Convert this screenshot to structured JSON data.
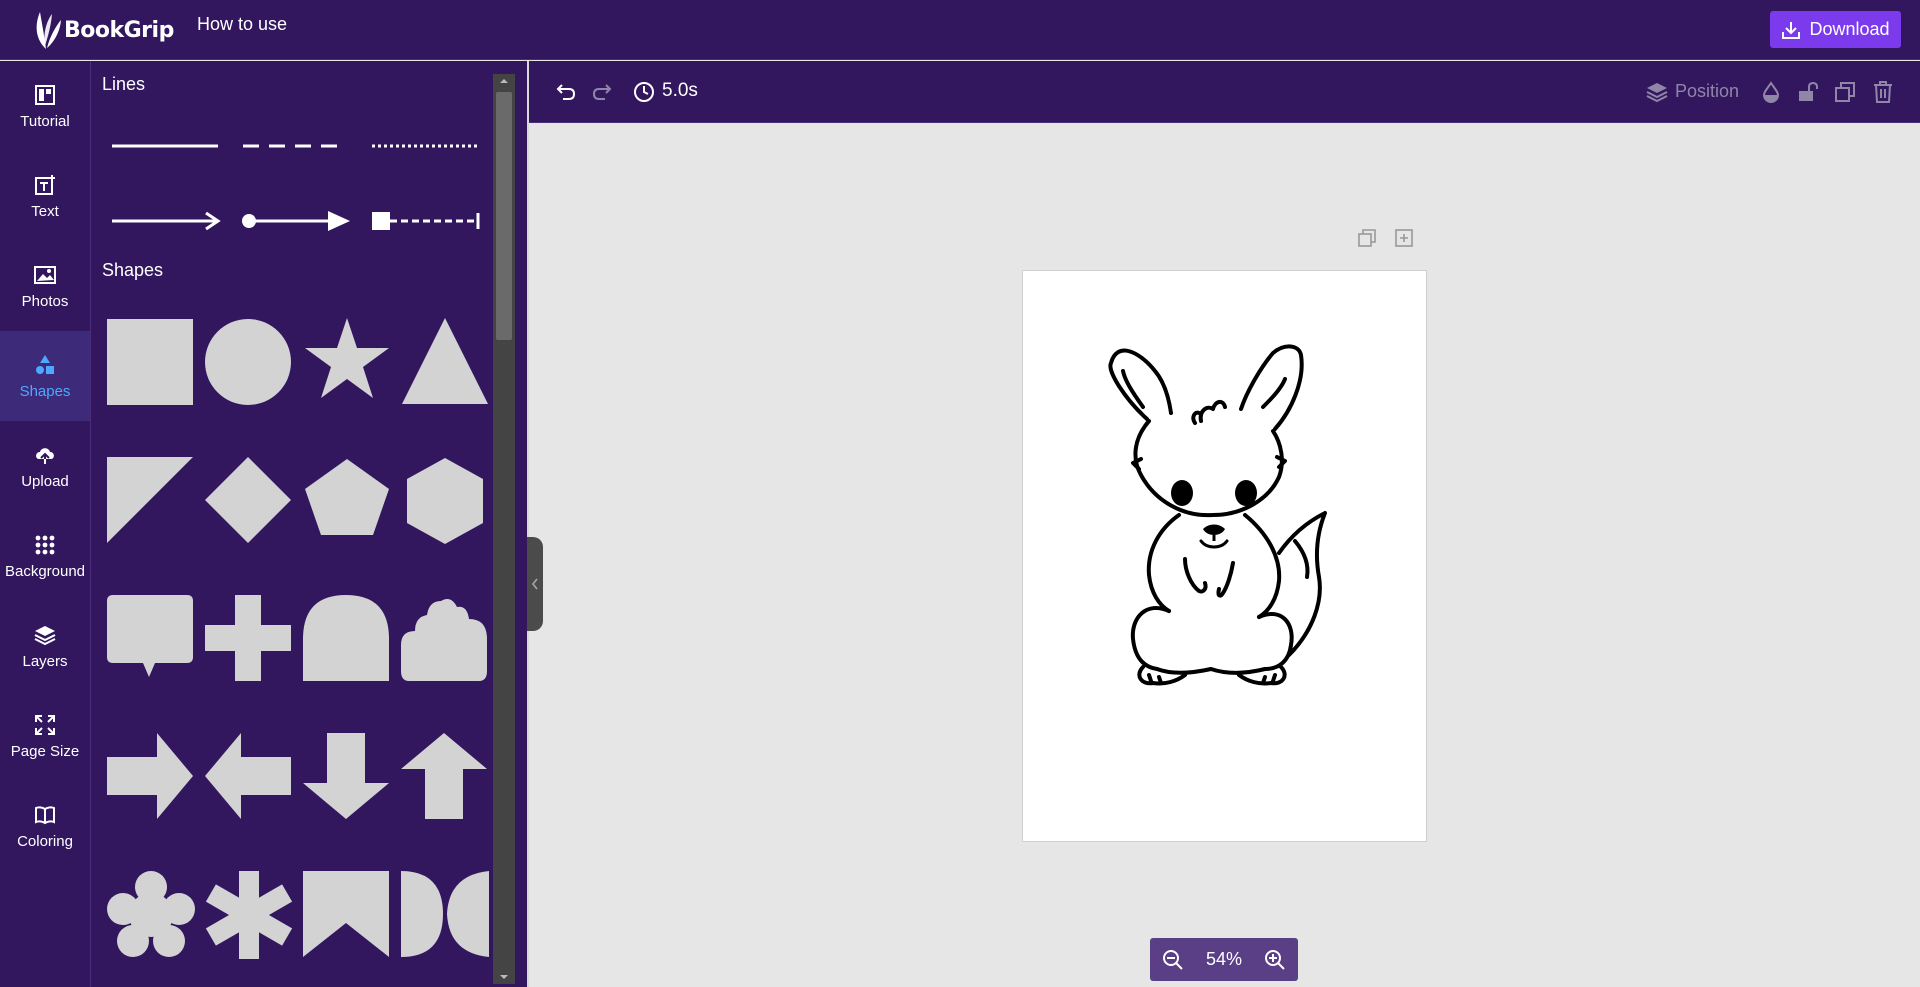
{
  "app": {
    "logo_text": "BookGrip"
  },
  "header": {
    "how_to_use": "How to use",
    "download_label": "Download"
  },
  "nav": {
    "items": [
      {
        "label": "Tutorial",
        "icon": "tutorial-icon"
      },
      {
        "label": "Text",
        "icon": "text-icon"
      },
      {
        "label": "Photos",
        "icon": "photos-icon"
      },
      {
        "label": "Shapes",
        "icon": "shapes-icon",
        "active": true
      },
      {
        "label": "Upload",
        "icon": "upload-icon"
      },
      {
        "label": "Background",
        "icon": "background-icon"
      },
      {
        "label": "Layers",
        "icon": "layers-icon"
      },
      {
        "label": "Page Size",
        "icon": "page-size-icon"
      },
      {
        "label": "Coloring",
        "icon": "coloring-icon"
      }
    ]
  },
  "panel": {
    "lines_title": "Lines",
    "shapes_title": "Shapes",
    "lines": [
      "solid-line",
      "dashed-line",
      "dotted-line",
      "arrow-line",
      "dot-arrow-line",
      "square-dashed-line"
    ],
    "shapes": [
      "square",
      "circle",
      "star",
      "triangle",
      "right-triangle",
      "diamond",
      "pentagon",
      "hexagon",
      "speech-bubble",
      "plus",
      "arch",
      "cloud",
      "arrow-right",
      "arrow-left",
      "arrow-down",
      "arrow-up",
      "flower",
      "asterisk",
      "bookmark",
      "half-circles"
    ]
  },
  "toolbar": {
    "duration": "5.0s",
    "position_label": "Position"
  },
  "zoom": {
    "level": "54%"
  },
  "colors": {
    "brand_purple": "#32175f",
    "accent": "#7c3aed",
    "active_text": "#4fa8ff",
    "shape_fill": "#d3d3d3"
  }
}
